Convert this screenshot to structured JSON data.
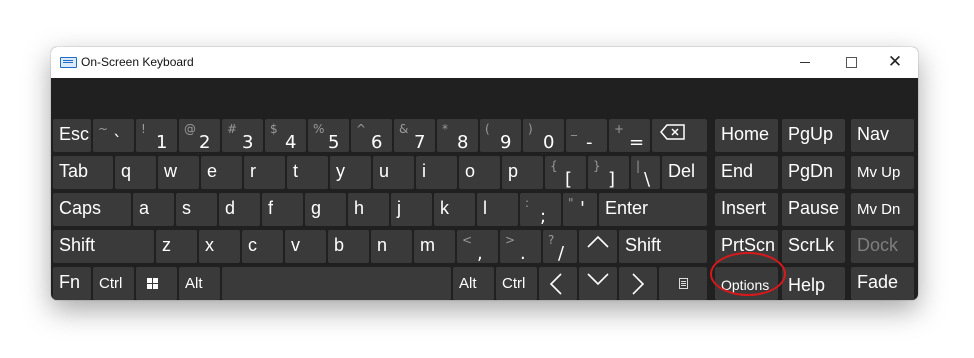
{
  "window": {
    "title": "On-Screen Keyboard",
    "icon": "keyboard-icon",
    "controls": {
      "minimize": "minimize-icon",
      "maximize": "maximize-icon",
      "close": "close-icon"
    }
  },
  "colors": {
    "key_bg": "#3a3a3a",
    "panel_bg": "#202020",
    "highlight": "#d7191c"
  },
  "keys": {
    "esc": "Esc",
    "tilde": {
      "sup": "~",
      "main": "`"
    },
    "n1": {
      "sup": "!",
      "main": "1"
    },
    "n2": {
      "sup": "@",
      "main": "2"
    },
    "n3": {
      "sup": "#",
      "main": "3"
    },
    "n4": {
      "sup": "$",
      "main": "4"
    },
    "n5": {
      "sup": "%",
      "main": "5"
    },
    "n6": {
      "sup": "^",
      "main": "6"
    },
    "n7": {
      "sup": "&",
      "main": "7"
    },
    "n8": {
      "sup": "*",
      "main": "8"
    },
    "n9": {
      "sup": "(",
      "main": "9"
    },
    "n0": {
      "sup": ")",
      "main": "0"
    },
    "minus": {
      "sup": "_",
      "main": "-"
    },
    "equals": {
      "sup": "+",
      "main": "="
    },
    "tab": "Tab",
    "q": "q",
    "w": "w",
    "e": "e",
    "r": "r",
    "t": "t",
    "y": "y",
    "u": "u",
    "i": "i",
    "o": "o",
    "p": "p",
    "lbracket": {
      "sup": "{",
      "main": "["
    },
    "rbracket": {
      "sup": "}",
      "main": "]"
    },
    "backslash": {
      "sup": "|",
      "main": "\\"
    },
    "del": "Del",
    "caps": "Caps",
    "a": "a",
    "s": "s",
    "d": "d",
    "f": "f",
    "g": "g",
    "h": "h",
    "j": "j",
    "k": "k",
    "l": "l",
    "semicolon": {
      "sup": ":",
      "main": ";"
    },
    "quote": {
      "sup": "\"",
      "main": "'"
    },
    "enter": "Enter",
    "shift_left": "Shift",
    "z": "z",
    "x": "x",
    "c": "c",
    "v": "v",
    "b": "b",
    "n": "n",
    "m": "m",
    "comma": {
      "sup": "<",
      "main": ","
    },
    "period": {
      "sup": ">",
      "main": "."
    },
    "slash": {
      "sup": "?",
      "main": "/"
    },
    "up": "^",
    "shift_right": "Shift",
    "fn": "Fn",
    "ctrl_left": "Ctrl",
    "alt_left": "Alt",
    "alt_right": "Alt",
    "ctrl_right": "Ctrl",
    "left": "<",
    "down": "v",
    "right": ">",
    "home": "Home",
    "pgup": "PgUp",
    "nav": "Nav",
    "end": "End",
    "pgdn": "PgDn",
    "mvup": "Mv Up",
    "insert": "Insert",
    "pause": "Pause",
    "mvdn": "Mv Dn",
    "prtscn": "PrtScn",
    "scrlk": "ScrLk",
    "dock": "Dock",
    "options": "Options",
    "help": "Help",
    "fade": "Fade"
  }
}
